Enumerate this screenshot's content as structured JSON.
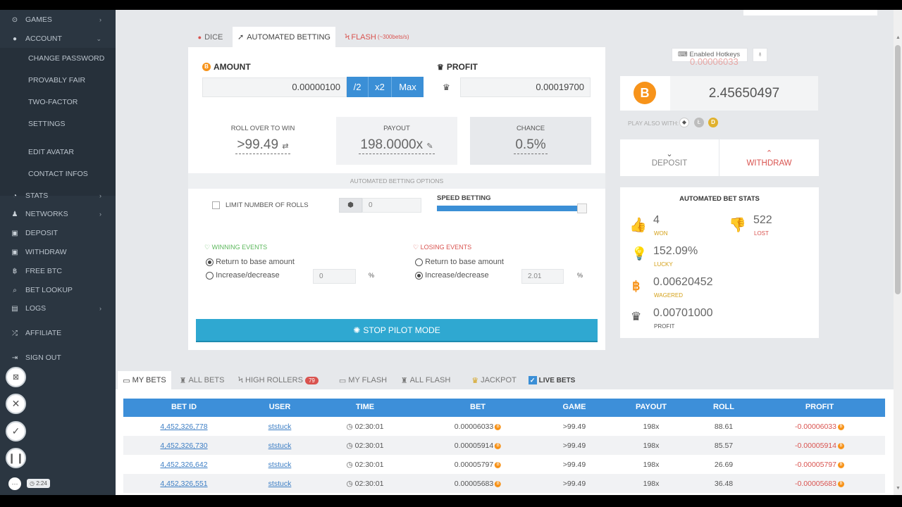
{
  "sidebar": {
    "items": [
      {
        "label": "GAMES",
        "icon": "gamepad-icon",
        "chev": "›"
      },
      {
        "label": "ACCOUNT",
        "icon": "user-icon",
        "chev": "⌄"
      },
      {
        "label": "STATS",
        "icon": "pie-chart-icon",
        "chev": "›"
      },
      {
        "label": "NETWORKS",
        "icon": "users-icon",
        "chev": "›"
      },
      {
        "label": "DEPOSIT",
        "icon": "deposit-icon",
        "chev": ""
      },
      {
        "label": "WITHDRAW",
        "icon": "withdraw-icon",
        "chev": ""
      },
      {
        "label": "FREE BTC",
        "icon": "bitcoin-icon",
        "chev": ""
      },
      {
        "label": "BET LOOKUP",
        "icon": "search-icon",
        "chev": ""
      },
      {
        "label": "LOGS",
        "icon": "book-icon",
        "chev": "›"
      },
      {
        "label": "AFFILIATE",
        "icon": "shuffle-icon",
        "chev": ""
      },
      {
        "label": "SIGN OUT",
        "icon": "sign-out-icon",
        "chev": ""
      }
    ],
    "account_sub": [
      "CHANGE PASSWORD",
      "PROVABLY FAIR",
      "TWO-FACTOR",
      "SETTINGS",
      "EDIT AVATAR",
      "CONTACT INFOS"
    ],
    "timer": "2:24"
  },
  "game_tabs": {
    "dice": "DICE",
    "auto": "AUTOMATED BETTING",
    "flash": "FLASH",
    "flash_note": "(~300bets/s)"
  },
  "bet": {
    "amount_label": "AMOUNT",
    "amount_value": "0.00000100",
    "half": "/2",
    "double": "x2",
    "max": "Max",
    "profit_label": "PROFIT",
    "profit_value": "0.00019700",
    "roll_label": "ROLL OVER TO WIN",
    "roll_value": ">99.49",
    "payout_label": "PAYOUT",
    "payout_value": "198.0000x",
    "chance_label": "CHANCE",
    "chance_value": "0.5%"
  },
  "auto": {
    "options_title": "AUTOMATED BETTING OPTIONS",
    "limit_label": "LIMIT NUMBER OF ROLLS",
    "limit_value": "0",
    "speed_label": "SPEED BETTING",
    "speed_level": 0.97,
    "winning_title": "WINNING EVENTS",
    "losing_title": "LOSING EVENTS",
    "return_base": "Return to base amount",
    "increase": "Increase/decrease",
    "win_increase_value": "0",
    "lose_increase_value": "2.01",
    "percent": "%",
    "stop_label": "STOP PILOT MODE"
  },
  "wallet": {
    "hotkeys": "Enabled Hotkeys",
    "overlay": "0.00006033",
    "balance": "2.45650497",
    "play_also": "PLAY ALSO WITH:",
    "deposit": "DEPOSIT",
    "withdraw": "WITHDRAW"
  },
  "stats": {
    "title": "AUTOMATED BET STATS",
    "won_value": "4",
    "won_label": "WON",
    "lost_value": "522",
    "lost_label": "LOST",
    "lucky_value": "152.09%",
    "lucky_label": "LUCKY",
    "wagered_value": "0.00620452",
    "wagered_label": "WAGERED",
    "profit_value": "0.00701000",
    "profit_label": "PROFIT"
  },
  "bet_tabs": {
    "my_bets": "MY BETS",
    "all_bets": "ALL BETS",
    "high_rollers": "HIGH ROLLERS",
    "high_rollers_count": "79",
    "my_flash": "MY FLASH",
    "all_flash": "ALL FLASH",
    "jackpot": "JACKPOT",
    "live_bets": "LIVE BETS"
  },
  "table": {
    "headers": [
      "BET ID",
      "USER",
      "TIME",
      "BET",
      "GAME",
      "PAYOUT",
      "ROLL",
      "PROFIT"
    ],
    "rows": [
      {
        "id": "4,452,326,778",
        "user": "ststuck",
        "time": "02:30:01",
        "bet": "0.00006033",
        "game": ">99.49",
        "payout": "198x",
        "roll": "88.61",
        "profit": "-0.00006033"
      },
      {
        "id": "4,452,326,730",
        "user": "ststuck",
        "time": "02:30:01",
        "bet": "0.00005914",
        "game": ">99.49",
        "payout": "198x",
        "roll": "85.57",
        "profit": "-0.00005914"
      },
      {
        "id": "4,452,326,642",
        "user": "ststuck",
        "time": "02:30:01",
        "bet": "0.00005797",
        "game": ">99.49",
        "payout": "198x",
        "roll": "26.69",
        "profit": "-0.00005797"
      },
      {
        "id": "4,452,326,551",
        "user": "ststuck",
        "time": "02:30:01",
        "bet": "0.00005683",
        "game": ">99.49",
        "payout": "198x",
        "roll": "36.48",
        "profit": "-0.00005683"
      }
    ]
  },
  "colors": {
    "accent": "#3b8fd6",
    "stop": "#2fa8d1",
    "bitcoin": "#f7931a",
    "loss": "#d9534f",
    "sidebar": "#2b3641"
  }
}
